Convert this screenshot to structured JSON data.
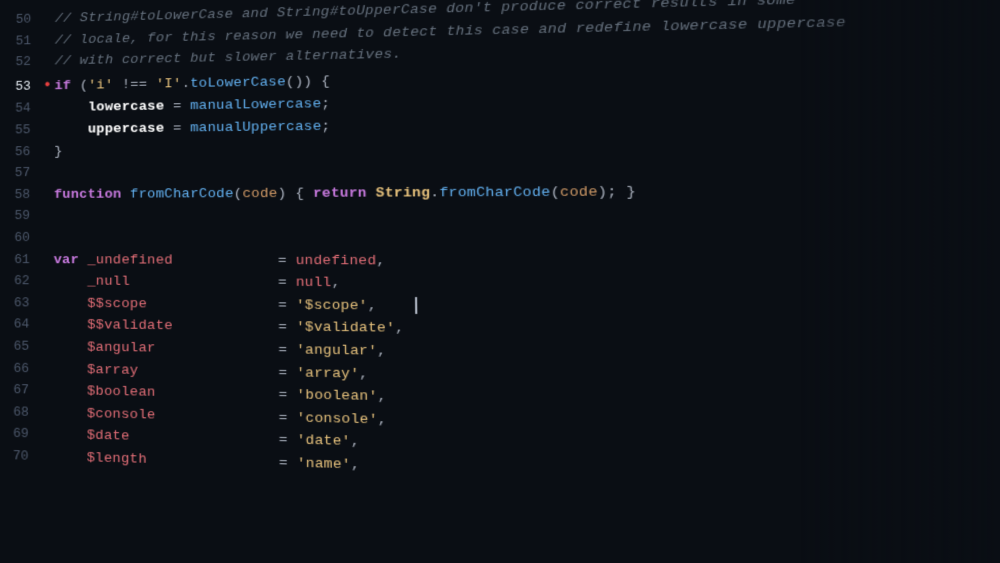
{
  "editor": {
    "background": "#0a0e14",
    "lines": [
      {
        "num": "50",
        "content": "comment_1",
        "dot": false
      },
      {
        "num": "51",
        "content": "comment_2",
        "dot": false
      },
      {
        "num": "52",
        "content": "comment_3",
        "dot": false
      },
      {
        "num": "53",
        "content": "if_statement",
        "dot": true
      },
      {
        "num": "54",
        "content": "lowercase_assign",
        "dot": false
      },
      {
        "num": "55",
        "content": "uppercase_assign",
        "dot": false
      },
      {
        "num": "56",
        "content": "close_brace",
        "dot": false
      },
      {
        "num": "57",
        "content": "empty",
        "dot": false
      },
      {
        "num": "58",
        "content": "function_def",
        "dot": false
      },
      {
        "num": "59",
        "content": "empty",
        "dot": false
      },
      {
        "num": "60",
        "content": "empty",
        "dot": false
      },
      {
        "num": "61",
        "content": "var_undefined",
        "dot": false
      },
      {
        "num": "62",
        "content": "null_line",
        "dot": false
      },
      {
        "num": "63",
        "content": "scope_line",
        "dot": false
      },
      {
        "num": "64",
        "content": "validate_line",
        "dot": false
      },
      {
        "num": "65",
        "content": "angular_line",
        "dot": false
      },
      {
        "num": "66",
        "content": "array_line",
        "dot": false
      },
      {
        "num": "67",
        "content": "boolean_line",
        "dot": false
      },
      {
        "num": "68",
        "content": "console_line",
        "dot": false
      },
      {
        "num": "69",
        "content": "date_line",
        "dot": false
      },
      {
        "num": "70",
        "content": "length_line",
        "dot": false
      }
    ]
  }
}
